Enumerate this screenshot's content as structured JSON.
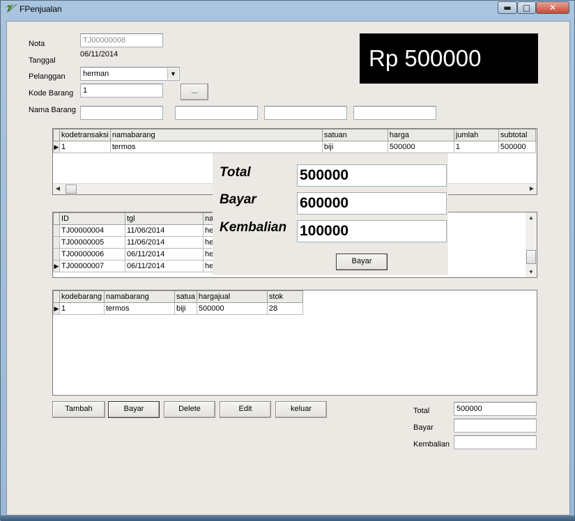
{
  "window": {
    "title": "FPenjualan",
    "icon": "delphi-app-icon",
    "min": "▬",
    "max": "□",
    "close": "✕"
  },
  "form": {
    "nota_label": "Nota",
    "nota_value": "TJ00000008",
    "tanggal_label": "Tanggal",
    "tanggal_value": "06/11/2014",
    "pelanggan_label": "Pelanggan",
    "pelanggan_value": "herman",
    "kode_barang_label": "Kode Barang",
    "kode_barang_value": "1",
    "browse_label": "...",
    "nama_barang_label": "Nama Barang"
  },
  "display": {
    "text": "Rp 500000"
  },
  "detail_grid": {
    "columns": [
      "kodetransaksi",
      "namabarang",
      "satuan",
      "harga",
      "jumlah",
      "subtotal"
    ],
    "rows": [
      [
        "1",
        "termos",
        "biji",
        "500000",
        "1",
        "500000"
      ]
    ]
  },
  "trans_grid": {
    "columns": [
      "ID",
      "tgl",
      "na"
    ],
    "rows": [
      [
        "TJ00000004",
        "11/06/2014",
        "he"
      ],
      [
        "TJ00000005",
        "11/06/2014",
        "he"
      ],
      [
        "TJ00000006",
        "06/11/2014",
        "he"
      ],
      [
        "TJ00000007",
        "06/11/2014",
        "he"
      ]
    ]
  },
  "stock_grid": {
    "columns": [
      "kodebarang",
      "namabarang",
      "satua",
      "hargajual",
      "stok"
    ],
    "rows": [
      [
        "1",
        "termos",
        "biji",
        "500000",
        "28"
      ]
    ]
  },
  "payment_panel": {
    "total_label": "Total",
    "total_value": "500000",
    "bayar_label": "Bayar",
    "bayar_value": "600000",
    "kembalian_label": "Kembalian",
    "kembalian_value": "100000",
    "button": "Bayar"
  },
  "buttons": {
    "tambah": "Tambah",
    "bayar": "Bayar",
    "delete": "Delete",
    "edit": "Edit",
    "keluar": "keluar"
  },
  "summary": {
    "total_label": "Total",
    "total_value": "500000",
    "bayar_label": "Bayar",
    "bayar_value": "",
    "kembalian_label": "Kembalian",
    "kembalian_value": ""
  }
}
